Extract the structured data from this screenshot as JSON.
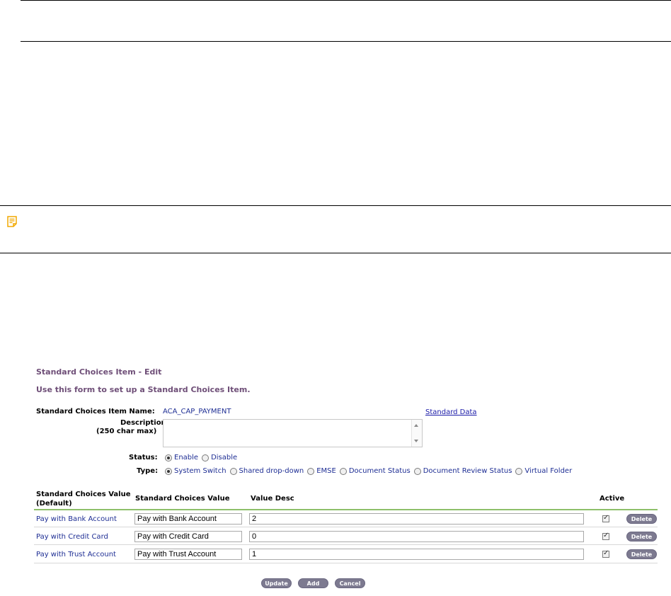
{
  "form": {
    "title": "Standard Choices Item - Edit",
    "subtitle": "Use this form to set up a Standard Choices Item.",
    "item_name_label": "Standard Choices Item Name:",
    "item_name_value": "ACA_CAP_PAYMENT",
    "standard_data_link": "Standard Data",
    "description_label": "Description:",
    "description_hint": "(250 char max)",
    "description_value": "",
    "status_label": "Status:",
    "status_options": [
      "Enable",
      "Disable"
    ],
    "status_selected": "Enable",
    "type_label": "Type:",
    "type_options": [
      "System Switch",
      "Shared drop-down",
      "EMSE",
      "Document Status",
      "Document Review Status",
      "Virtual Folder"
    ],
    "type_selected": "System Switch"
  },
  "table": {
    "headers": {
      "default_line1": "Standard Choices Value",
      "default_line2": "(Default)",
      "value": "Standard Choices Value",
      "desc": "Value Desc",
      "active": "Active"
    },
    "rows": [
      {
        "default": "Pay with Bank Account",
        "value": "Pay with Bank Account",
        "desc": "2",
        "active": true,
        "delete": "Delete"
      },
      {
        "default": "Pay with Credit Card",
        "value": "Pay with Credit Card",
        "desc": "0",
        "active": true,
        "delete": "Delete"
      },
      {
        "default": "Pay with Trust Account",
        "value": "Pay with Trust Account",
        "desc": "1",
        "active": true,
        "delete": "Delete"
      }
    ]
  },
  "buttons": {
    "update": "Update",
    "add": "Add",
    "cancel": "Cancel"
  },
  "colors": {
    "title": "#6f4f78",
    "value_text": "#1e2e94",
    "button": "#7d7a90",
    "table_header_rule": "#8ec06a",
    "note_icon": "#f2a900"
  },
  "icons": {
    "note": "note-icon"
  }
}
